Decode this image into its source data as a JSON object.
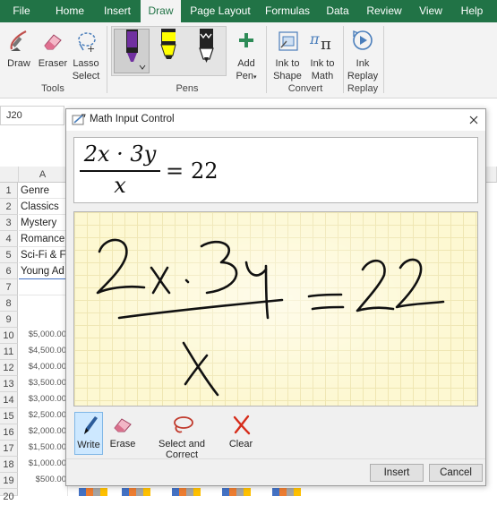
{
  "ribbon": {
    "tabs": [
      "File",
      "Home",
      "Insert",
      "Draw",
      "Page Layout",
      "Formulas",
      "Data",
      "Review",
      "View",
      "Help"
    ],
    "active_tab": "Draw",
    "tools": {
      "draw": "Draw",
      "eraser": "Eraser",
      "lasso_1": "Lasso",
      "lasso_2": "Select",
      "group": "Tools"
    },
    "pens": {
      "add_1": "Add",
      "add_2": "Pen",
      "group": "Pens"
    },
    "convert": {
      "shape_1": "Ink to",
      "shape_2": "Shape",
      "math_1": "Ink to",
      "math_2": "Math",
      "group": "Convert"
    },
    "replay": {
      "label_1": "Ink",
      "label_2": "Replay",
      "group": "Replay"
    },
    "accent": "#217346"
  },
  "sheet": {
    "name_box": "J20",
    "column_a": "A",
    "rows": [
      "1",
      "2",
      "3",
      "4",
      "5",
      "6",
      "7",
      "8",
      "9",
      "10",
      "11",
      "12",
      "13",
      "14",
      "15",
      "16",
      "17",
      "18",
      "19",
      "20"
    ],
    "cells": [
      "Genre",
      "Classics",
      "Mystery",
      "Romance",
      "Sci-Fi & F",
      "Young Ad"
    ],
    "axis_labels": [
      "$5,000.00",
      "$4,500.00",
      "$4,000.00",
      "$3,500.00",
      "$3,000.00",
      "$2,500.00",
      "$2,000.00",
      "$1,500.00",
      "$1,000.00",
      "$500.00"
    ]
  },
  "dialog": {
    "title": "Math Input Control",
    "preview": {
      "numerator": "2x · 3y",
      "denominator": "x",
      "equals": "=",
      "rhs": "22"
    },
    "handwriting": "2x · 3y / x = 22",
    "tools": {
      "write": "Write",
      "erase": "Erase",
      "select_correct": "Select and Correct",
      "clear": "Clear"
    },
    "buttons": {
      "insert": "Insert",
      "cancel": "Cancel"
    }
  }
}
